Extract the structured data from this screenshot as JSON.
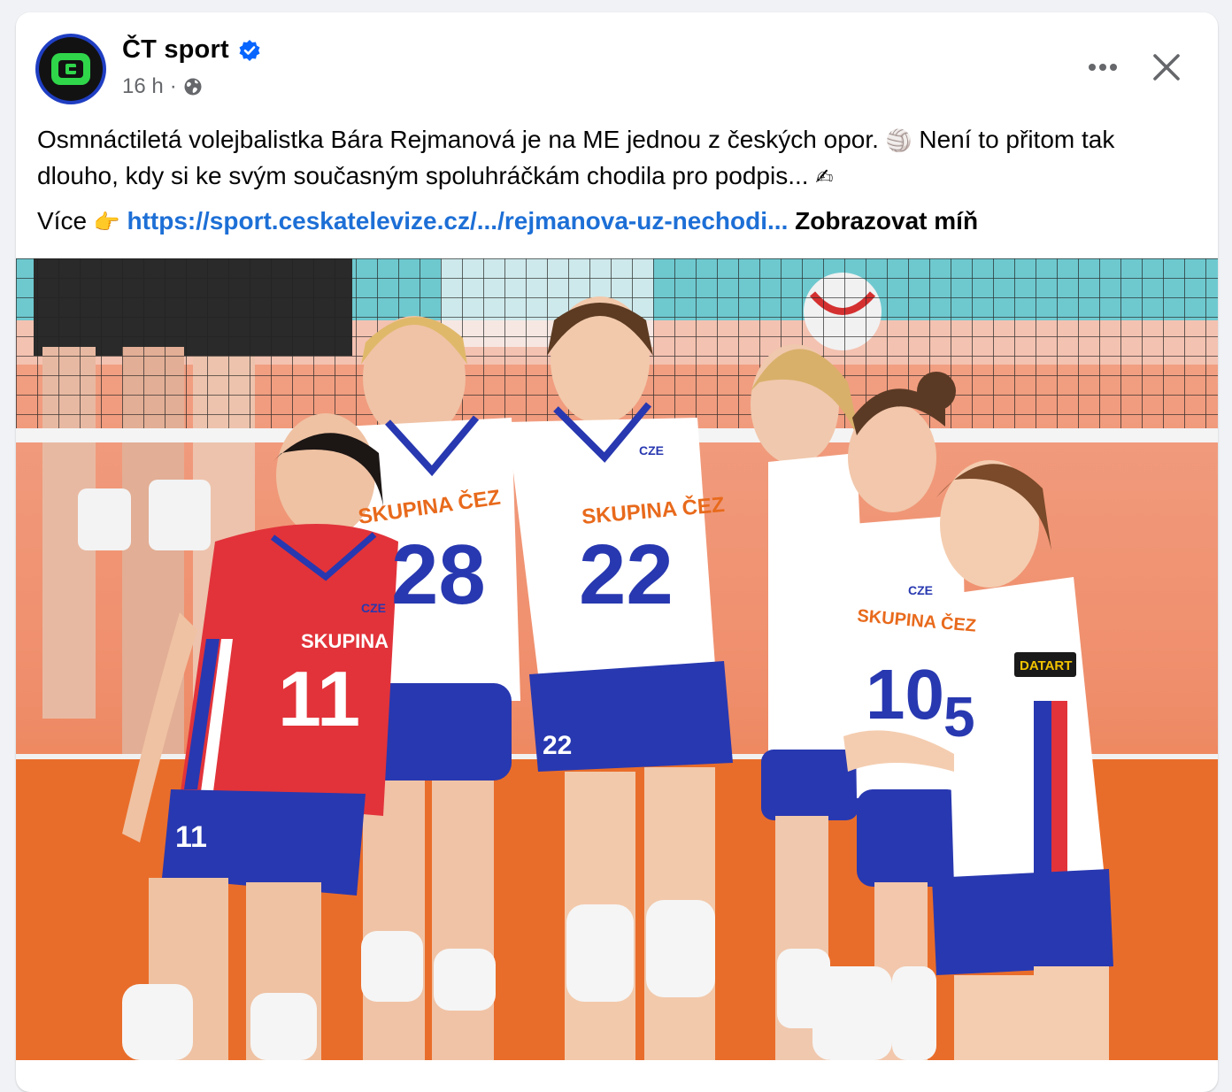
{
  "post": {
    "page_name": "ČT sport",
    "time": "16 h",
    "separator": "·",
    "text_main": "Osmnáctiletá volejbalistka Bára Rejmanová je na ME jednou z českých opor.",
    "emoji_ball": "🏐",
    "text_cont": "Není to přitom tak dlouho, kdy si ke svým současným spoluhráčkám chodila pro podpis...",
    "emoji_hand": "✍",
    "more_prefix": "Více",
    "emoji_point": "👉",
    "link_text": "https://sport.ceskatelevize.cz/.../rejmanova-uz-nechodi...",
    "show_less": "Zobrazovat míň"
  },
  "photo": {
    "jerseys": {
      "front_shirt": "SKUPINA ČEZ",
      "n11": "11",
      "n28": "28",
      "n22": "22",
      "n10": "10",
      "n5": "5",
      "country": "CZE",
      "sponsor": "DATART"
    }
  },
  "icons": {
    "avatar": "ct-sport-logo-icon",
    "verified": "verified-badge-icon",
    "audience": "globe-icon",
    "more": "more-options-icon",
    "close": "close-icon"
  },
  "colors": {
    "accent_link": "#1d6fd6",
    "verified_blue": "#0866ff",
    "court_orange": "#e5712e",
    "jersey_red": "#e2333a",
    "jersey_blue": "#2838b0"
  }
}
